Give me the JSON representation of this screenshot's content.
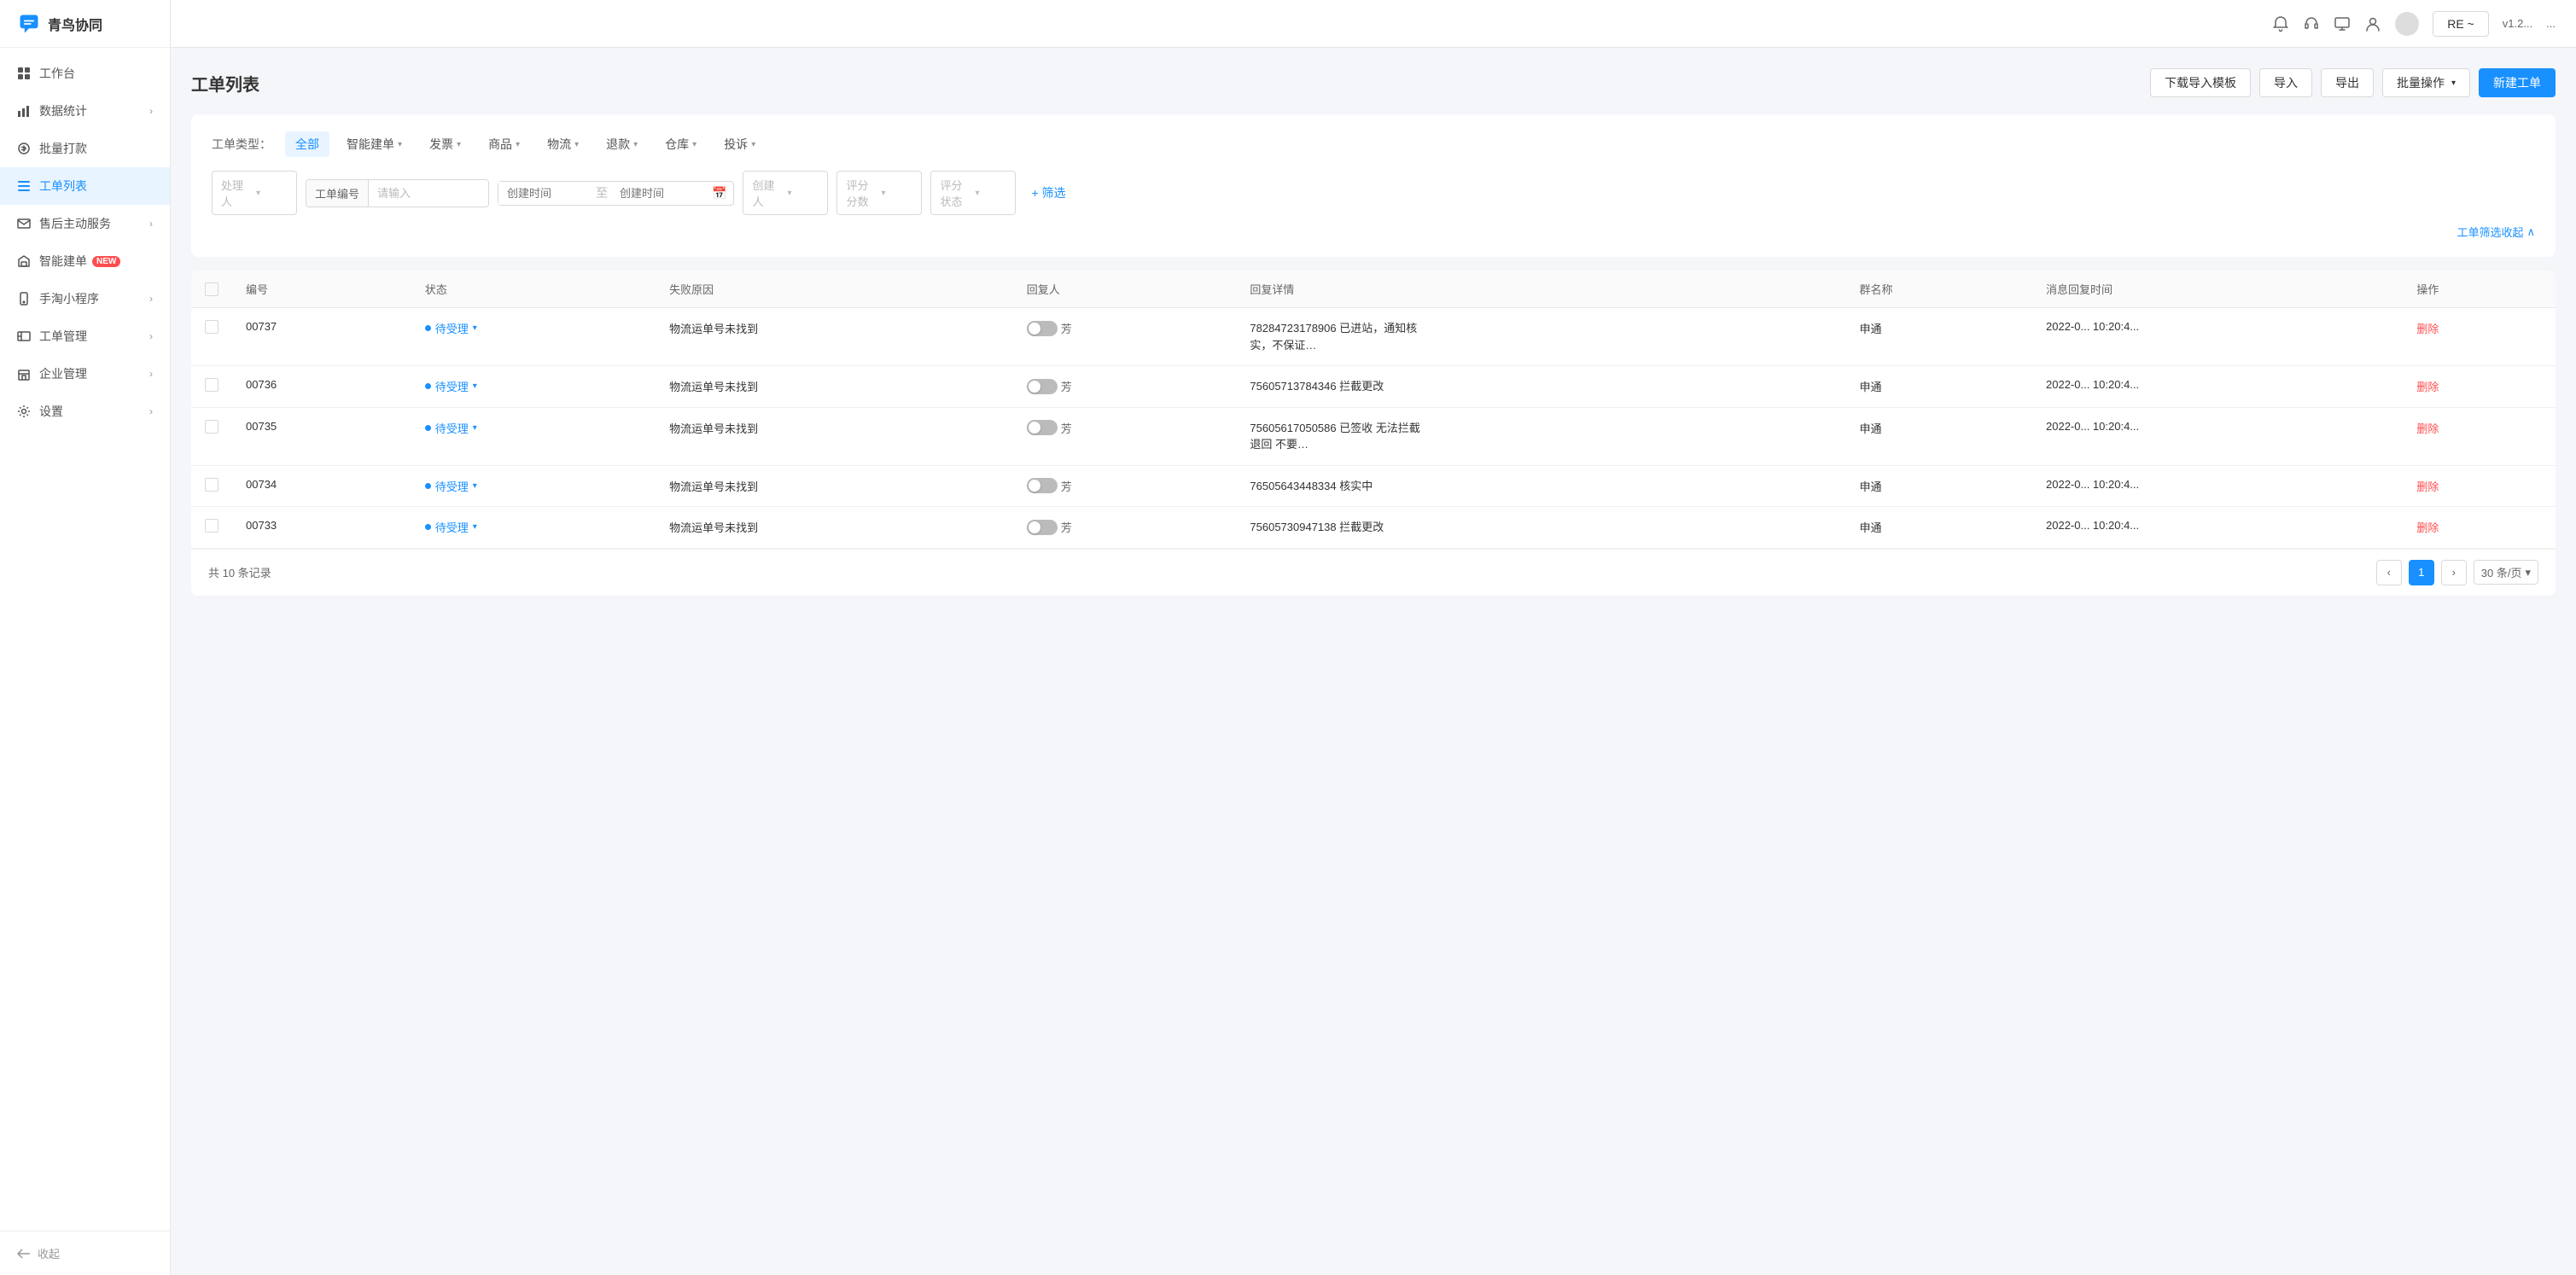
{
  "app": {
    "name": "青鸟协同"
  },
  "sidebar": {
    "items": [
      {
        "id": "workbench",
        "label": "工作台",
        "icon": "grid-icon",
        "active": false,
        "hasChevron": false,
        "badge": null
      },
      {
        "id": "data-stats",
        "label": "数据统计",
        "icon": "bar-chart-icon",
        "active": false,
        "hasChevron": true,
        "badge": null
      },
      {
        "id": "batch-pay",
        "label": "批量打款",
        "icon": "circle-icon",
        "active": false,
        "hasChevron": false,
        "badge": null
      },
      {
        "id": "ticket-list",
        "label": "工单列表",
        "icon": "list-icon",
        "active": true,
        "hasChevron": false,
        "badge": null
      },
      {
        "id": "after-sales",
        "label": "售后主动服务",
        "icon": "mail-icon",
        "active": false,
        "hasChevron": true,
        "badge": null
      },
      {
        "id": "smart-order",
        "label": "智能建单",
        "icon": "smart-icon",
        "active": false,
        "hasChevron": false,
        "badge": "NEW"
      },
      {
        "id": "mini-app",
        "label": "手淘小程序",
        "icon": "phone-icon",
        "active": false,
        "hasChevron": true,
        "badge": null
      },
      {
        "id": "ticket-mgmt",
        "label": "工单管理",
        "icon": "ticket-icon",
        "active": false,
        "hasChevron": true,
        "badge": null
      },
      {
        "id": "corp-mgmt",
        "label": "企业管理",
        "icon": "building-icon",
        "active": false,
        "hasChevron": true,
        "badge": null
      },
      {
        "id": "settings",
        "label": "设置",
        "icon": "settings-icon",
        "active": false,
        "hasChevron": true,
        "badge": null
      }
    ],
    "footer_label": "收起"
  },
  "header": {
    "icons": [
      "bell-icon",
      "headset-icon",
      "screen-icon",
      "user-icon"
    ],
    "button_label": "RE ~",
    "texts": [
      "v1.2....",
      "..."
    ]
  },
  "page": {
    "title": "工单列表",
    "actions": {
      "download_template": "下载导入模板",
      "import": "导入",
      "export": "导出",
      "batch_ops": "批量操作",
      "new_ticket": "新建工单"
    }
  },
  "filters": {
    "ticket_type_label": "工单类型：",
    "tabs": [
      {
        "label": "全部",
        "active": true,
        "dropdown": false
      },
      {
        "label": "智能建单",
        "active": false,
        "dropdown": true
      },
      {
        "label": "发票",
        "active": false,
        "dropdown": true
      },
      {
        "label": "商品",
        "active": false,
        "dropdown": true
      },
      {
        "label": "物流",
        "active": false,
        "dropdown": true
      },
      {
        "label": "退款",
        "active": false,
        "dropdown": true
      },
      {
        "label": "仓库",
        "active": false,
        "dropdown": true
      },
      {
        "label": "投诉",
        "active": false,
        "dropdown": true
      }
    ],
    "handler_placeholder": "处理人",
    "ticket_number_label": "工单编号",
    "ticket_number_placeholder": "请输入",
    "create_time_start": "创建时间",
    "create_time_end": "创建时间",
    "creator_placeholder": "创建人",
    "score_placeholder": "评分分数",
    "score_status_placeholder": "评分状态",
    "add_filter": "+ 筛选",
    "collapse_link": "工单筛选收起",
    "collapse_icon": "chevron-up"
  },
  "table": {
    "columns": [
      {
        "key": "checkbox",
        "label": ""
      },
      {
        "key": "number",
        "label": "编号"
      },
      {
        "key": "status",
        "label": "状态"
      },
      {
        "key": "fail_reason",
        "label": "失败原因"
      },
      {
        "key": "replier",
        "label": "回复人"
      },
      {
        "key": "reply_detail",
        "label": "回复详情"
      },
      {
        "key": "group_name",
        "label": "群名称"
      },
      {
        "key": "message_time",
        "label": "消息回复时间"
      },
      {
        "key": "action",
        "label": "操作"
      }
    ],
    "rows": [
      {
        "number": "00737",
        "status": "待受理",
        "fail_reason": "物流运单号未找到",
        "replier": "芳",
        "reply_detail": "78284723178906 已进站，通知核实，不保证…",
        "group_name": "申通",
        "message_time": "2022-0... 10:20:4...",
        "action": "删除"
      },
      {
        "number": "00736",
        "status": "待受理",
        "fail_reason": "物流运单号未找到",
        "replier": "芳",
        "reply_detail": "75605713784346 拦截更改",
        "group_name": "申通",
        "message_time": "2022-0... 10:20:4...",
        "action": "删除"
      },
      {
        "number": "00735",
        "status": "待受理",
        "fail_reason": "物流运单号未找到",
        "replier": "芳",
        "reply_detail": "75605617050586 已签收 无法拦截退回 不要…",
        "group_name": "申通",
        "message_time": "2022-0... 10:20:4...",
        "action": "删除"
      },
      {
        "number": "00734",
        "status": "待受理",
        "fail_reason": "物流运单号未找到",
        "replier": "芳",
        "reply_detail": "76505643448334 核实中",
        "group_name": "申通",
        "message_time": "2022-0... 10:20:4...",
        "action": "删除"
      },
      {
        "number": "00733",
        "status": "待受理",
        "fail_reason": "物流运单号未找到",
        "replier": "芳",
        "reply_detail": "75605730947138 拦截更改",
        "group_name": "申通",
        "message_time": "2022-0... 10:20:4...",
        "action": "删除"
      }
    ],
    "total_label": "共 10 条记录",
    "current_page": "1",
    "page_size": "30 条/页"
  }
}
